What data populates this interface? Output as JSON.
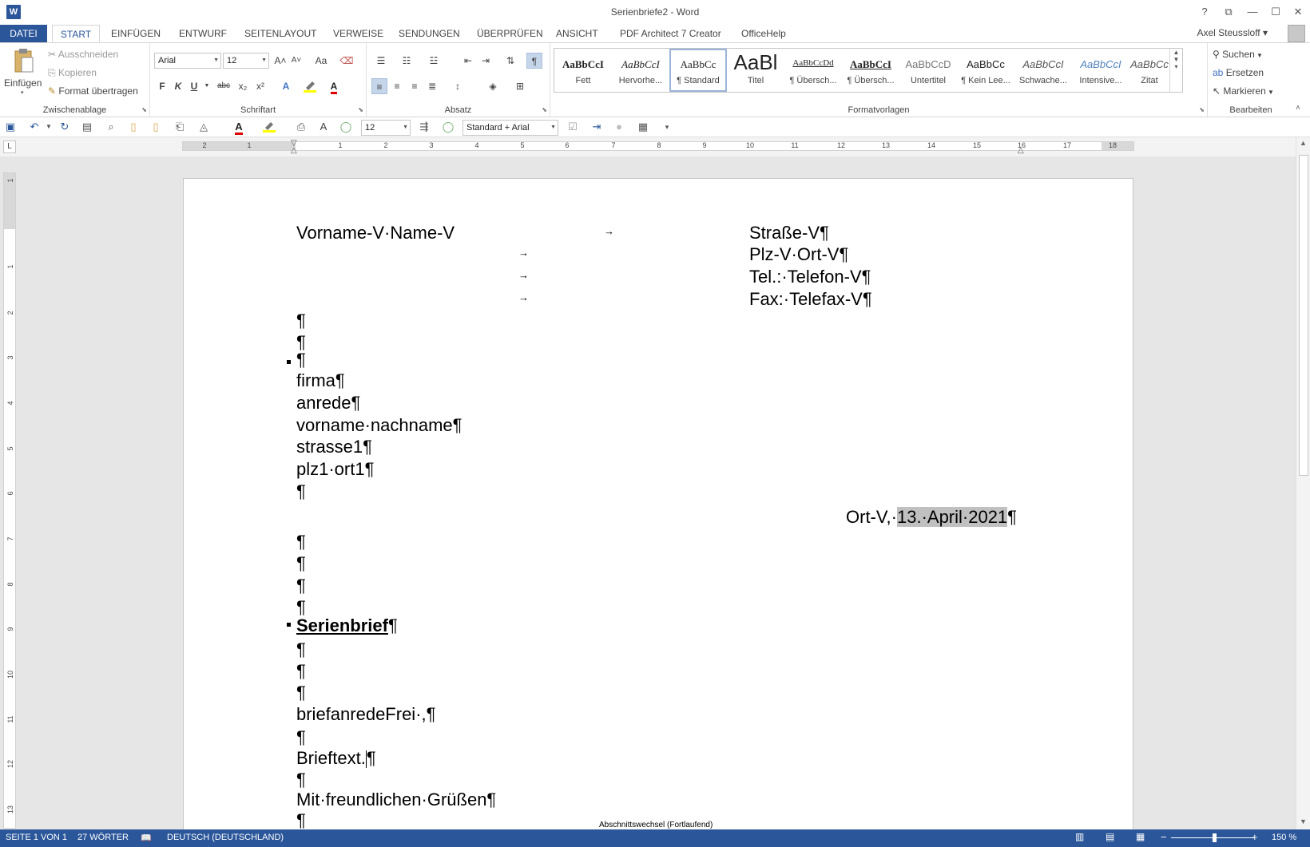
{
  "window": {
    "title": "Serienbriefe2 - Word",
    "app_icon": "W",
    "help_icon": "?",
    "restore_ribbon_icon": "⧉",
    "minimize_icon": "—",
    "maximize_icon": "☐",
    "close_icon": "✕"
  },
  "ribbon_tabs": {
    "datei": "DATEI",
    "start": "START",
    "einfuegen": "EINFÜGEN",
    "entwurf": "ENTWURF",
    "seitenlayout": "SEITENLAYOUT",
    "verweise": "VERWEISE",
    "sendungen": "SENDUNGEN",
    "ueberpruefen": "ÜBERPRÜFEN",
    "ansicht": "ANSICHT",
    "pdf_architect": "PDF Architect 7 Creator",
    "officehelp": "OfficeHelp"
  },
  "user": {
    "name": "Axel Steussloff ▾"
  },
  "clipboard": {
    "label": "Zwischenablage",
    "paste": "Einfügen",
    "paste_arrow": "▾",
    "cut": "Ausschneiden",
    "copy": "Kopieren",
    "format_painter": "Format übertragen"
  },
  "font": {
    "label": "Schriftart",
    "font_name": "Arial",
    "font_size": "12",
    "grow": "A˄",
    "shrink": "A˅",
    "case": "Aa",
    "bold": "F",
    "italic": "K",
    "underline": "U",
    "strike": "abc",
    "subscript": "x₂",
    "superscript": "x²"
  },
  "paragraph": {
    "label": "Absatz",
    "pilcrow": "¶"
  },
  "styles": {
    "label": "Formatvorlagen",
    "items": [
      {
        "sample": "AaBbCcI",
        "name": "Fett"
      },
      {
        "sample": "AaBbCcI",
        "name": "Hervorhe..."
      },
      {
        "sample": "AaBbCc",
        "name": "¶ Standard"
      },
      {
        "sample": "AaBl",
        "name": "Titel"
      },
      {
        "sample": "AaBbCcDd",
        "name": "¶ Übersch..."
      },
      {
        "sample": "AaBbCcI",
        "name": "¶ Übersch..."
      },
      {
        "sample": "AaBbCcD",
        "name": "Untertitel"
      },
      {
        "sample": "AaBbCc",
        "name": "¶ Kein Lee..."
      },
      {
        "sample": "AaBbCcI",
        "name": "Schwache..."
      },
      {
        "sample": "AaBbCcI",
        "name": "Intensive..."
      },
      {
        "sample": "AaBbCc",
        "name": "Zitat"
      }
    ]
  },
  "editing": {
    "label": "Bearbeiten",
    "find": "Suchen",
    "replace": "Ersetzen",
    "select": "Markieren"
  },
  "qat": {
    "font_size": "12",
    "style_combo": "Standard + Arial",
    "font_color_letter": "A"
  },
  "ruler": {
    "h_numbers": [
      "2",
      "1",
      "1",
      "2",
      "3",
      "4",
      "5",
      "6",
      "7",
      "8",
      "9",
      "10",
      "11",
      "12",
      "13",
      "14",
      "15",
      "16",
      "17",
      "18"
    ],
    "v_numbers": [
      "1",
      "1",
      "2",
      "3",
      "4",
      "5",
      "6",
      "7",
      "8",
      "9",
      "10",
      "11",
      "12",
      "13"
    ],
    "corner": "L"
  },
  "document": {
    "sender_name": "Vorname-V·Name-V",
    "sender_street": "Straße-V¶",
    "sender_city": "Plz-V·Ort-V¶",
    "sender_tel": "Tel.:·Telefon-V¶",
    "sender_fax": "Fax:·Telefax-V¶",
    "pilcrow": "¶",
    "tab_arrow": "→",
    "field_firma": "firma¶",
    "field_anrede": "anrede¶",
    "field_name": "vorname·nachname¶",
    "field_strasse": "strasse1¶",
    "field_plzort": "plz1·ort1¶",
    "date_prefix": "Ort-V,·",
    "date_value": "13.·April·2021",
    "date_pilcrow": "¶",
    "subject": "Serienbrief",
    "salutation": "briefanredeFrei·,¶",
    "body_text": "Brieftext.",
    "closing": "Mit·freundlichen·Grüßen¶",
    "section_break": "Abschnittswechsel (Fortlaufend)"
  },
  "statusbar": {
    "page": "SEITE 1 VON 1",
    "words": "27 WÖRTER",
    "language": "DEUTSCH (DEUTSCHLAND)",
    "zoom": "150 %",
    "zoom_minus": "−",
    "zoom_plus": "+"
  },
  "colors": {
    "accent": "#2b579a",
    "highlight": "#c0c0c0",
    "font_color_red": "#e00000",
    "highlighter_yellow": "#ffff00"
  }
}
